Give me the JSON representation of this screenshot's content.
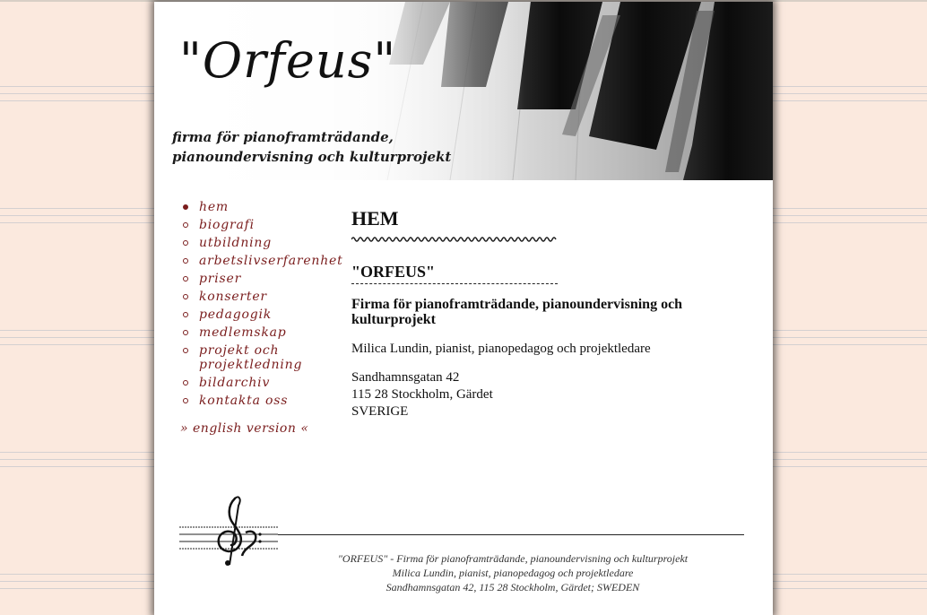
{
  "header": {
    "logo": "\"Orfeus\"",
    "tagline_line1": "firma för pianoframträdande,",
    "tagline_line2": "pianoundervisning och kulturprojekt"
  },
  "nav": {
    "items": [
      {
        "label": "hem",
        "active": true
      },
      {
        "label": "biografi",
        "active": false
      },
      {
        "label": "utbildning",
        "active": false
      },
      {
        "label": "arbetslivserfarenhet",
        "active": false
      },
      {
        "label": "priser",
        "active": false
      },
      {
        "label": "konserter",
        "active": false
      },
      {
        "label": "pedagogik",
        "active": false
      },
      {
        "label": "medlemskap",
        "active": false
      },
      {
        "label": "projekt och projektledning",
        "active": false
      },
      {
        "label": "bildarchiv",
        "active": false
      },
      {
        "label": "kontakta oss",
        "active": false
      }
    ],
    "english_link": "» english version «"
  },
  "main": {
    "heading": "HEM",
    "subheading": "\"ORFEUS\"",
    "firm_description": "Firma för pianoframträdande, pianoundervisning och kulturprojekt",
    "person": "Milica Lundin, pianist, pianopedagog och projektledare",
    "address_line1": "Sandhamnsgatan 42",
    "address_line2": "115 28 Stockholm, Gärdet",
    "address_line3": "SVERIGE"
  },
  "footer": {
    "line1": "\"ORFEUS\" - Firma för pianoframträdande, pianoundervisning och kulturprojekt",
    "line2": "Milica Lundin, pianist, pianopedagog och projektledare",
    "line3": "Sandhamnsgatan 42, 115 28 Stockholm, Gärdet; SWEDEN"
  },
  "colors": {
    "link": "#7a1d1d",
    "background": "#fbe9de",
    "text": "#111111"
  },
  "icons": [
    "bullet-icon",
    "treble-clef-icon",
    "wavy-underline",
    "piano-keys-image"
  ]
}
